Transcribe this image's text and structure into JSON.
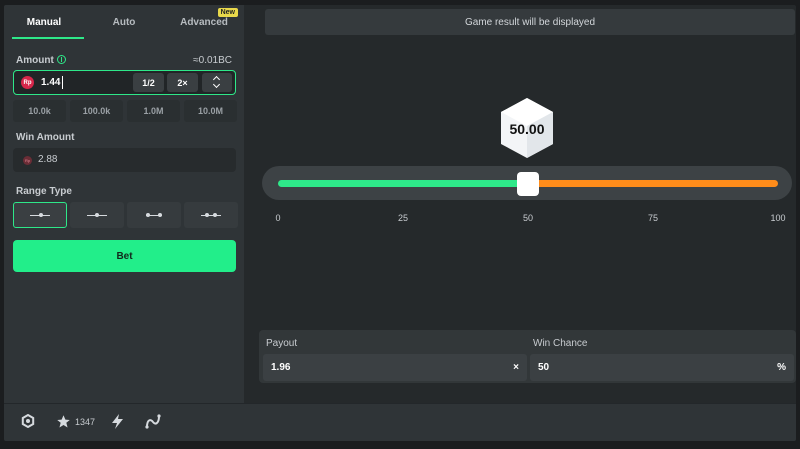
{
  "tabs": [
    {
      "label": "Manual",
      "active": true
    },
    {
      "label": "Auto",
      "active": false
    },
    {
      "label": "Advanced",
      "active": false,
      "badge": "New"
    }
  ],
  "amount": {
    "label": "Amount",
    "approx": "≈0.01BC",
    "currency_badge": "Rp",
    "value": "1.44",
    "half_label": "1/2",
    "double_label": "2×"
  },
  "quick_amounts": [
    "10.0k",
    "100.0k",
    "1.0M",
    "10.0M"
  ],
  "win_amount": {
    "label": "Win Amount",
    "currency_badge": "Rp",
    "value": "2.88"
  },
  "range_type": {
    "label": "Range Type",
    "options": [
      "range-left",
      "range-right",
      "range-inside",
      "range-outside"
    ],
    "selected": 0
  },
  "bet_label": "Bet",
  "footer": {
    "star_count": "1347",
    "icons": [
      "settings-icon",
      "star-icon",
      "lightning-icon",
      "fairness-icon"
    ]
  },
  "result_text": "Game result will be displayed",
  "dice_value": "50.00",
  "slider": {
    "value": 50,
    "min": 0,
    "max": 100,
    "ticks": [
      "0",
      "25",
      "50",
      "75",
      "100"
    ],
    "colors": {
      "low": "#2ee889",
      "high": "#ff8c1a"
    }
  },
  "payout": {
    "label": "Payout",
    "value": "1.96",
    "unit": "×"
  },
  "win_chance": {
    "label": "Win Chance",
    "value": "50",
    "unit": "%"
  },
  "colors": {
    "accent": "#2ee889",
    "bet_button": "#22ee8a",
    "badge": "#e9d94b"
  }
}
